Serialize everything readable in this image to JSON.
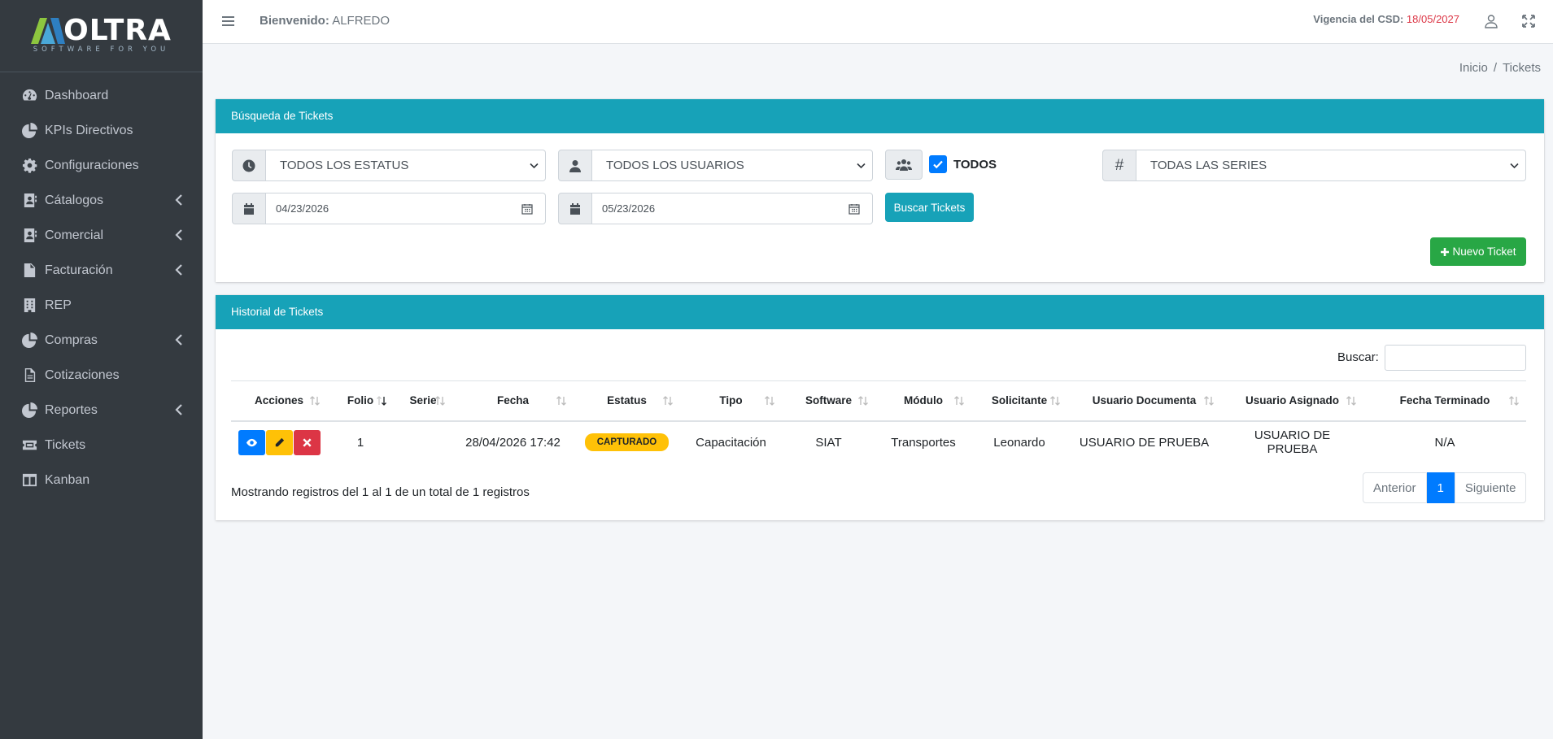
{
  "brand": {
    "name": "OLTRA",
    "tagline": "SOFTWARE FOR YOU"
  },
  "sidebar": {
    "items": [
      {
        "label": "Dashboard",
        "icon": "tachometer-icon",
        "has_arrow": false
      },
      {
        "label": "KPIs Directivos",
        "icon": "pie-chart-icon",
        "has_arrow": false
      },
      {
        "label": "Configuraciones",
        "icon": "gear-icon",
        "has_arrow": false
      },
      {
        "label": "Cátalogos",
        "icon": "address-book-icon",
        "has_arrow": true
      },
      {
        "label": "Comercial",
        "icon": "address-book-icon",
        "has_arrow": true
      },
      {
        "label": "Facturación",
        "icon": "invoice-icon",
        "has_arrow": true
      },
      {
        "label": "REP",
        "icon": "building-icon",
        "has_arrow": false
      },
      {
        "label": "Compras",
        "icon": "pie-chart-icon",
        "has_arrow": true
      },
      {
        "label": "Cotizaciones",
        "icon": "file-icon",
        "has_arrow": false
      },
      {
        "label": "Reportes",
        "icon": "pie-chart-icon",
        "has_arrow": true
      },
      {
        "label": "Tickets",
        "icon": "ticket-icon",
        "has_arrow": false
      },
      {
        "label": "Kanban",
        "icon": "columns-icon",
        "has_arrow": false
      }
    ]
  },
  "topbar": {
    "welcome_label": "Bienvenido:",
    "user": "ALFREDO",
    "csd_label": "Vigencia del CSD:",
    "csd_date": "18/05/2027"
  },
  "breadcrumb": {
    "home": "Inicio",
    "separator": "/",
    "current": "Tickets"
  },
  "search_card": {
    "title": "Búsqueda de Tickets",
    "status_select": "TODOS LOS ESTATUS",
    "users_select": "TODOS LOS USUARIOS",
    "todos_label": "TODOS",
    "series_select": "TODAS LAS SERIES",
    "series_addon": "#",
    "date_from": "04/23/2026",
    "date_to": "05/23/2026",
    "search_button": "Buscar Tickets",
    "new_button": "Nuevo Ticket"
  },
  "history_card": {
    "title": "Historial de Tickets",
    "search_label": "Buscar:",
    "columns": [
      "Acciones",
      "Folio",
      "Serie",
      "Fecha",
      "Estatus",
      "Tipo",
      "Software",
      "Módulo",
      "Solicitante",
      "Usuario Documenta",
      "Usuario Asignado",
      "Fecha Terminado"
    ],
    "rows": [
      {
        "folio": "1",
        "serie": "",
        "fecha": "28/04/2026 17:42",
        "estatus": "CAPTURADO",
        "tipo": "Capacitación",
        "software": "SIAT",
        "modulo": "Transportes",
        "solicitante": "Leonardo",
        "usuario_documenta": "USUARIO DE PRUEBA",
        "usuario_asignado": "USUARIO DE PRUEBA",
        "fecha_terminado": "N/A"
      }
    ],
    "info": "Mostrando registros del 1 al 1 de un total de 1 registros",
    "pagination": {
      "prev": "Anterior",
      "page": "1",
      "next": "Siguiente"
    }
  },
  "colors": {
    "sidebar_bg": "#343a40",
    "header_bg": "#17a2b8",
    "primary": "#007bff",
    "warning": "#ffc107",
    "danger": "#dc3545",
    "success": "#28a745"
  }
}
